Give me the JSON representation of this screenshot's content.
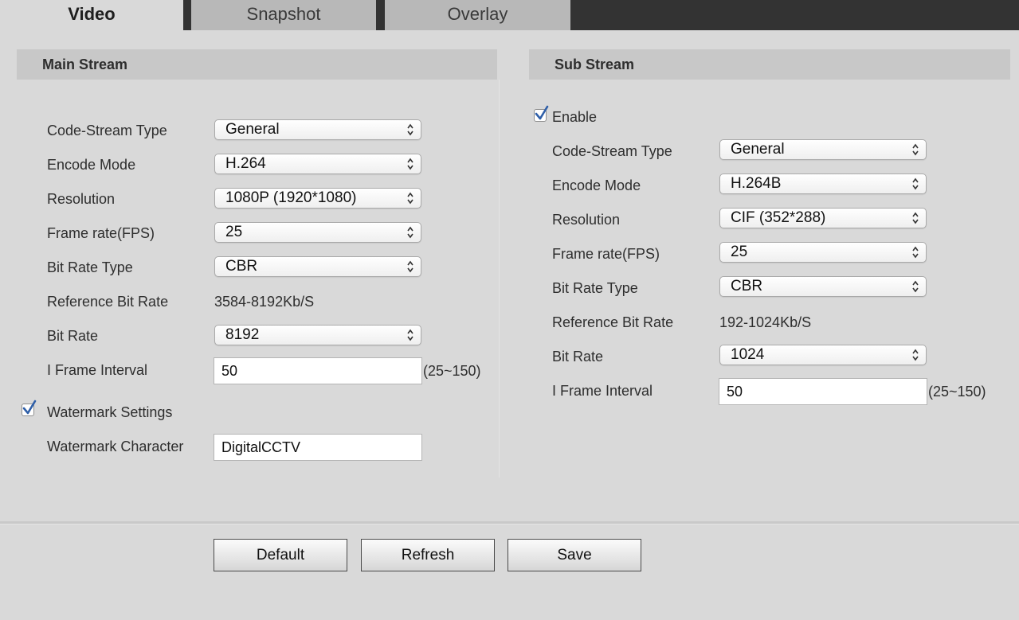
{
  "tabs": [
    {
      "label": "Video",
      "active": true
    },
    {
      "label": "Snapshot",
      "active": false
    },
    {
      "label": "Overlay",
      "active": false
    }
  ],
  "main_stream": {
    "title": "Main Stream",
    "code_stream_type": {
      "label": "Code-Stream Type",
      "value": "General"
    },
    "encode_mode": {
      "label": "Encode Mode",
      "value": "H.264"
    },
    "resolution": {
      "label": "Resolution",
      "value": "1080P (1920*1080)"
    },
    "frame_rate": {
      "label": "Frame rate(FPS)",
      "value": "25"
    },
    "bit_rate_type": {
      "label": "Bit Rate Type",
      "value": "CBR"
    },
    "reference_bit_rate": {
      "label": "Reference Bit Rate",
      "value": "3584-8192Kb/S"
    },
    "bit_rate": {
      "label": "Bit Rate",
      "value": "8192"
    },
    "i_frame_interval": {
      "label": "I Frame Interval",
      "value": "50",
      "range": "(25~150)"
    },
    "watermark_settings": {
      "label": "Watermark Settings",
      "checked": true
    },
    "watermark_character": {
      "label": "Watermark Character",
      "value": "DigitalCCTV"
    }
  },
  "sub_stream": {
    "title": "Sub Stream",
    "enable": {
      "label": "Enable",
      "checked": true
    },
    "code_stream_type": {
      "label": "Code-Stream Type",
      "value": "General"
    },
    "encode_mode": {
      "label": "Encode Mode",
      "value": "H.264B"
    },
    "resolution": {
      "label": "Resolution",
      "value": "CIF (352*288)"
    },
    "frame_rate": {
      "label": "Frame rate(FPS)",
      "value": "25"
    },
    "bit_rate_type": {
      "label": "Bit Rate Type",
      "value": "CBR"
    },
    "reference_bit_rate": {
      "label": "Reference Bit Rate",
      "value": "192-1024Kb/S"
    },
    "bit_rate": {
      "label": "Bit Rate",
      "value": "1024"
    },
    "i_frame_interval": {
      "label": "I Frame Interval",
      "value": "50",
      "range": "(25~150)"
    }
  },
  "buttons": {
    "default": "Default",
    "refresh": "Refresh",
    "save": "Save"
  },
  "icons": {
    "select_chevron": "updown-chevron-icon",
    "checkmark": "checkmark-icon"
  },
  "colors": {
    "background": "#d9d9d9",
    "tabbar": "#333333",
    "tab_inactive": "#b8b8b8",
    "panel_header": "#c8c8c8",
    "checkmark": "#2f5fa8"
  }
}
